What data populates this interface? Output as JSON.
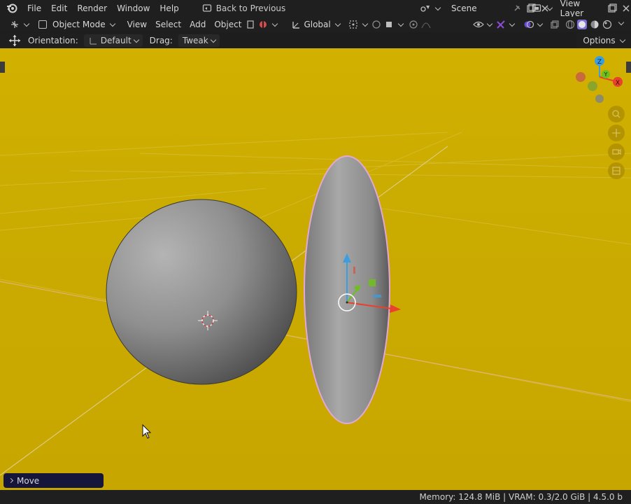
{
  "menu": {
    "items": [
      "File",
      "Edit",
      "Render",
      "Window",
      "Help"
    ],
    "back_label": "Back to Previous",
    "scene_label": "Scene",
    "view_layer_label": "View Layer"
  },
  "header": {
    "mode_label": "Object Mode",
    "view_label": "View",
    "select_label": "Select",
    "add_label": "Add",
    "object_label": "Object",
    "transform_label": "Global"
  },
  "tool_settings": {
    "orientation_label": "Orientation:",
    "orientation_value": "Default",
    "drag_label": "Drag:",
    "drag_value": "Tweak",
    "options_label": "Options"
  },
  "gizmo": {
    "z_label": "Z",
    "y_label": "Y",
    "x_label": "X"
  },
  "operator_panel": {
    "label": "Move"
  },
  "status": {
    "text": "Memory: 124.8 MiB | VRAM: 0.3/2.0 GiB | 4.5.0 b"
  },
  "colors": {
    "viewport_bg": "#c9a700",
    "ui_bg": "#1f1f1f",
    "selection_outline": "#e3a7d6",
    "axis_x": "#e8412c",
    "axis_y": "#6fbf1f",
    "axis_z": "#3a9ee0"
  }
}
